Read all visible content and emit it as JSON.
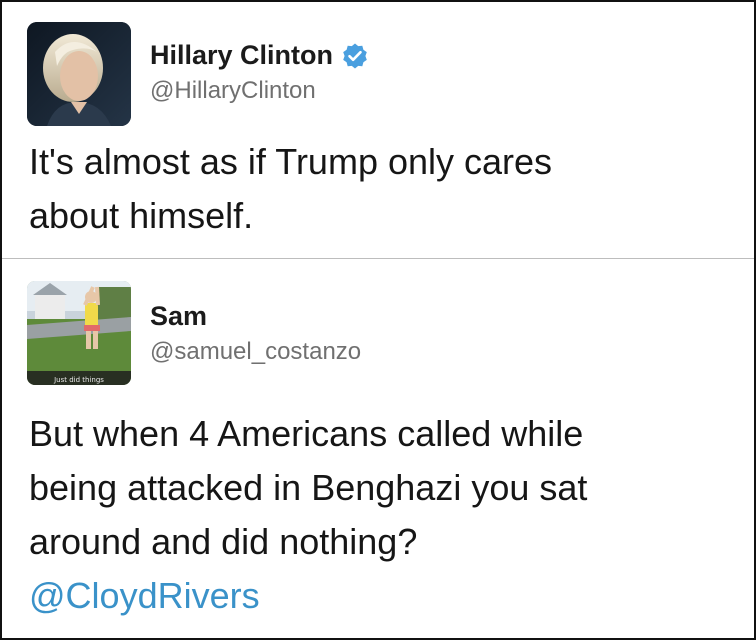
{
  "tweets": [
    {
      "display_name": "Hillary Clinton",
      "handle": "@HillaryClinton",
      "verified": true,
      "text_lines": [
        "It's almost as if Trump only cares",
        "about himself."
      ]
    },
    {
      "display_name": "Sam",
      "handle": "@samuel_costanzo",
      "verified": false,
      "avatar_caption": "Just did things",
      "text_lines": [
        "But when 4 Americans called while",
        "being attacked in Benghazi you sat",
        "around and did nothing?"
      ],
      "mention": "@CloydRivers"
    }
  ],
  "colors": {
    "verified_badge": "#4a9fdf",
    "mention": "#3a92c9",
    "handle": "#707070",
    "divider": "#bdbdbd"
  }
}
